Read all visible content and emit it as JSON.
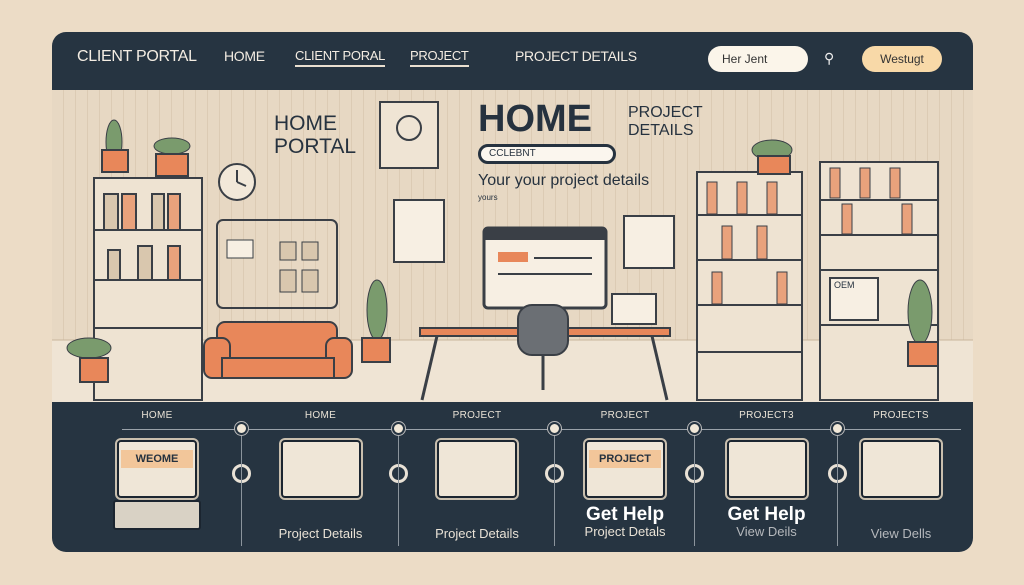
{
  "nav": {
    "brand": "CLIENT PORTAL",
    "items": [
      {
        "label": "HOME"
      },
      {
        "label": "CLIENT PORAL"
      },
      {
        "label": "PROJECT"
      },
      {
        "label": "PROJECT DETAILS"
      }
    ],
    "search_value": "Her Jent",
    "button_label": "Westugt"
  },
  "hero": {
    "left_title_1": "HOME",
    "left_title_2": "PORTAL",
    "title": "HOME",
    "side_1": "PROJECT",
    "side_2": "DETAILS",
    "pill": "CCLEBNT",
    "subtitle": "Your your project details",
    "small": "yours",
    "monitor_label": "OEM"
  },
  "steps": [
    {
      "label": "HOME",
      "title": "WEOME",
      "caption": ""
    },
    {
      "label": "HOME",
      "caption": "Project Details"
    },
    {
      "label": "PROJECT",
      "caption": "Project Details"
    },
    {
      "label": "PROJECT",
      "title": "PROJECT",
      "heading": "Get Help",
      "caption": "Project Detals"
    },
    {
      "label": "PROJECT3",
      "heading": "Get Help",
      "caption": "View Deils"
    },
    {
      "label": "PROJECTS",
      "caption": "View Dells"
    }
  ],
  "colors": {
    "frame": "#263441",
    "accent": "#e8875a",
    "wall": "#e7d8c3",
    "button": "#f8d9a8"
  }
}
